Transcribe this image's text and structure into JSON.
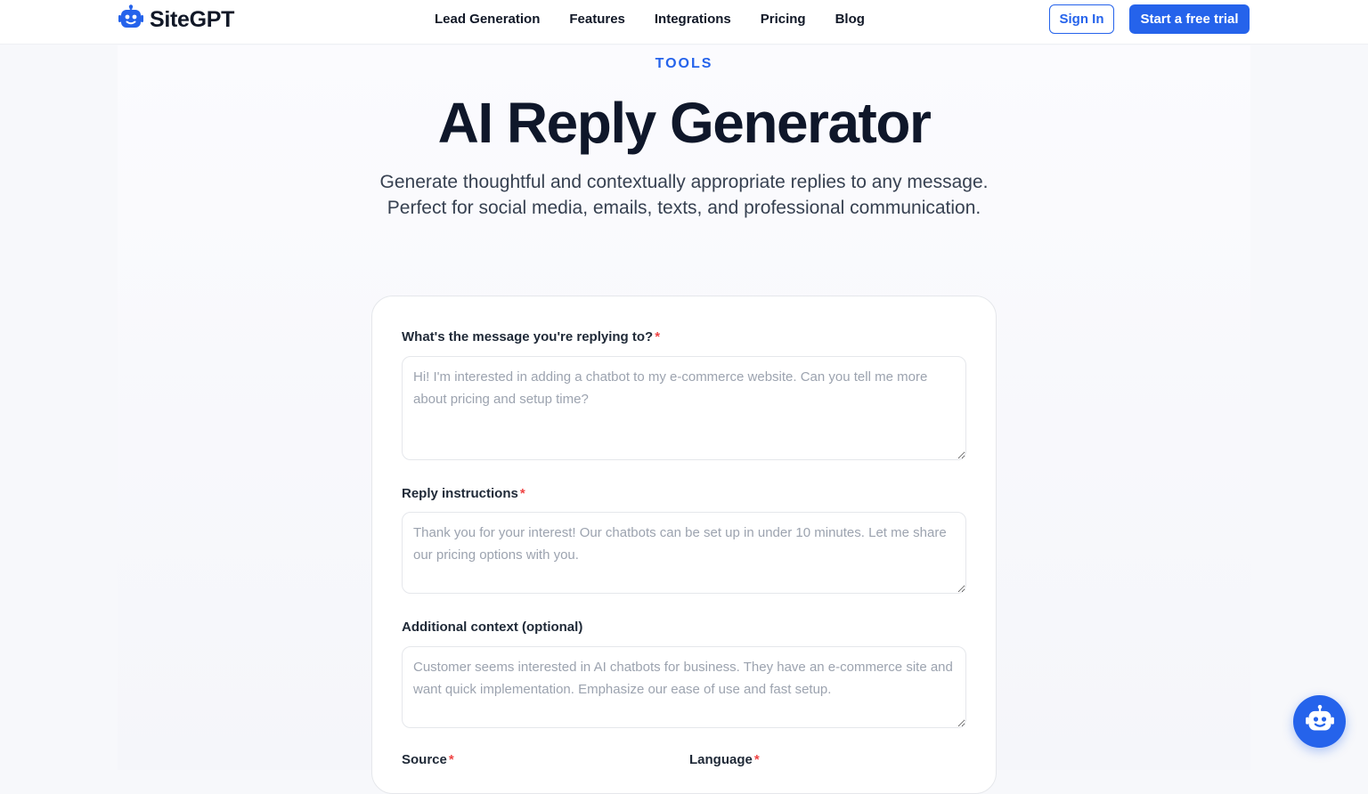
{
  "brand": {
    "name": "SiteGPT",
    "accent": "#2563eb"
  },
  "nav": {
    "items": [
      {
        "label": "Lead Generation"
      },
      {
        "label": "Features"
      },
      {
        "label": "Integrations"
      },
      {
        "label": "Pricing"
      },
      {
        "label": "Blog"
      }
    ],
    "sign_in": "Sign In",
    "trial": "Start a free trial"
  },
  "hero": {
    "eyebrow": "TOOLS",
    "title": "AI Reply Generator",
    "subtitle_line1": "Generate thoughtful and contextually appropriate replies to any message.",
    "subtitle_line2": "Perfect for social media, emails, texts, and professional communication."
  },
  "form": {
    "message": {
      "label": "What's the message you're replying to?",
      "required": "*",
      "placeholder": "Hi! I'm interested in adding a chatbot to my e-commerce website. Can you tell me more about pricing and setup time?"
    },
    "instructions": {
      "label": "Reply instructions",
      "required": "*",
      "placeholder": "Thank you for your interest! Our chatbots can be set up in under 10 minutes. Let me share our pricing options with you."
    },
    "context": {
      "label": "Additional context (optional)",
      "placeholder": "Customer seems interested in AI chatbots for business. They have an e-commerce site and want quick implementation. Emphasize our ease of use and fast setup."
    },
    "source": {
      "label": "Source",
      "required": "*"
    },
    "language": {
      "label": "Language",
      "required": "*"
    }
  },
  "chat_widget": {
    "icon": "robot-icon"
  }
}
